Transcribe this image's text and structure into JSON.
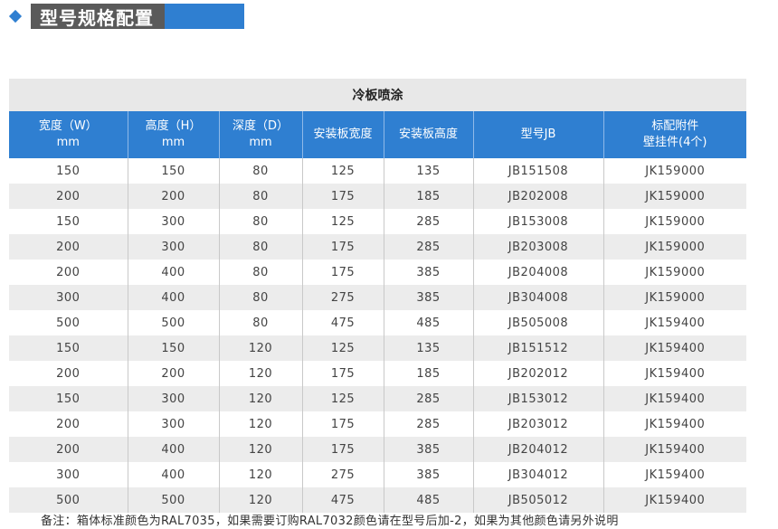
{
  "section": {
    "title": "型号规格配置"
  },
  "table": {
    "caption": "冷板喷涂",
    "headers": [
      {
        "line1": "宽度（W）",
        "line2": "mm"
      },
      {
        "line1": "高度（H）",
        "line2": "mm"
      },
      {
        "line1": "深度（D）",
        "line2": "mm"
      },
      {
        "line1": "安装板宽度",
        "line2": ""
      },
      {
        "line1": "安装板高度",
        "line2": ""
      },
      {
        "line1": "型号JB",
        "line2": ""
      },
      {
        "line1": "标配附件",
        "line2": "壁挂件(4个)"
      }
    ],
    "rows": [
      [
        "150",
        "150",
        "80",
        "125",
        "135",
        "JB151508",
        "JK159000"
      ],
      [
        "200",
        "200",
        "80",
        "175",
        "185",
        "JB202008",
        "JK159000"
      ],
      [
        "150",
        "300",
        "80",
        "125",
        "285",
        "JB153008",
        "JK159000"
      ],
      [
        "200",
        "300",
        "80",
        "175",
        "285",
        "JB203008",
        "JK159000"
      ],
      [
        "200",
        "400",
        "80",
        "175",
        "385",
        "JB204008",
        "JK159000"
      ],
      [
        "300",
        "400",
        "80",
        "275",
        "385",
        "JB304008",
        "JK159000"
      ],
      [
        "500",
        "500",
        "80",
        "475",
        "485",
        "JB505008",
        "JK159400"
      ],
      [
        "150",
        "150",
        "120",
        "125",
        "135",
        "JB151512",
        "JK159400"
      ],
      [
        "200",
        "200",
        "120",
        "175",
        "185",
        "JB202012",
        "JK159400"
      ],
      [
        "150",
        "300",
        "120",
        "125",
        "285",
        "JB153012",
        "JK159400"
      ],
      [
        "200",
        "300",
        "120",
        "175",
        "285",
        "JB203012",
        "JK159400"
      ],
      [
        "200",
        "400",
        "120",
        "175",
        "385",
        "JB204012",
        "JK159400"
      ],
      [
        "300",
        "400",
        "120",
        "275",
        "385",
        "JB304012",
        "JK159400"
      ],
      [
        "500",
        "500",
        "120",
        "475",
        "485",
        "JB505012",
        "JK159400"
      ]
    ]
  },
  "note": "备注：箱体标准颜色为RAL7035，如果需要订购RAL7032颜色请在型号后加-2，如果为其他颜色请另外说明",
  "colors": {
    "accent": "#2f7fd1",
    "title_bg": "#5a5a5a",
    "stripe": "#ececec"
  }
}
